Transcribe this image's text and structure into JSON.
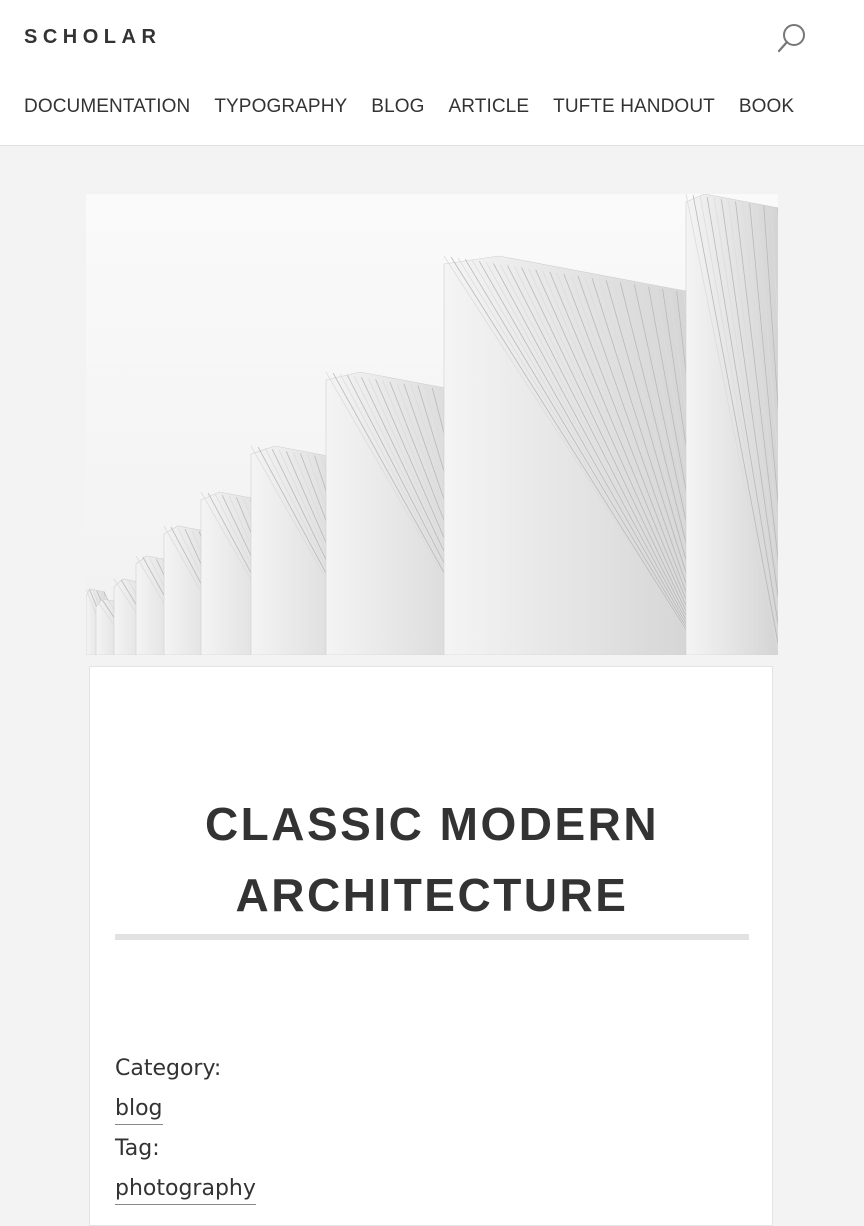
{
  "header": {
    "brand": "SCHOLAR",
    "search_icon": "search-icon",
    "nav": [
      {
        "label": "DOCUMENTATION"
      },
      {
        "label": "TYPOGRAPHY"
      },
      {
        "label": "BLOG"
      },
      {
        "label": "ARTICLE"
      },
      {
        "label": "TUFTE HANDOUT"
      },
      {
        "label": "BOOK"
      }
    ]
  },
  "post": {
    "title_line1": "CLASSIC MODERN",
    "title_line2": "ARCHITECTURE",
    "category_label": "Category:",
    "category": "blog",
    "tag_label": "Tag:",
    "tag": "photography"
  },
  "colors": {
    "background": "#f3f3f3",
    "text": "#333333",
    "card": "#ffffff",
    "rule": "#e2e2e2"
  }
}
